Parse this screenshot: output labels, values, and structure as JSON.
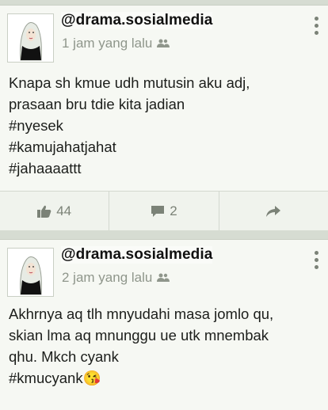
{
  "posts": [
    {
      "watermark": "@drama.sosialmedia",
      "time": "1 jam yang lalu",
      "audience_icon": "friends-icon",
      "lines": [
        "Knapa sh kmue udh mutusin aku adj,",
        "prasaan bru tdie kita jadian",
        "#nyesek",
        "#kamujahatjahat",
        "#jahaaaattt"
      ],
      "likes": "44",
      "comments": "2"
    },
    {
      "watermark": "@drama.sosialmedia",
      "time": "2 jam yang lalu",
      "audience_icon": "friends-icon",
      "lines": [
        "Akhrnya aq tlh mnyudahi masa jomlo qu,",
        "skian lma aq mnunggu ue utk mnembak",
        "qhu. Mkch cyank",
        "#kmucyank"
      ],
      "emoji": "😘"
    }
  ],
  "colors": {
    "background": "#d6dcd2",
    "card": "#f6f8f3",
    "muted": "#8f968b"
  }
}
